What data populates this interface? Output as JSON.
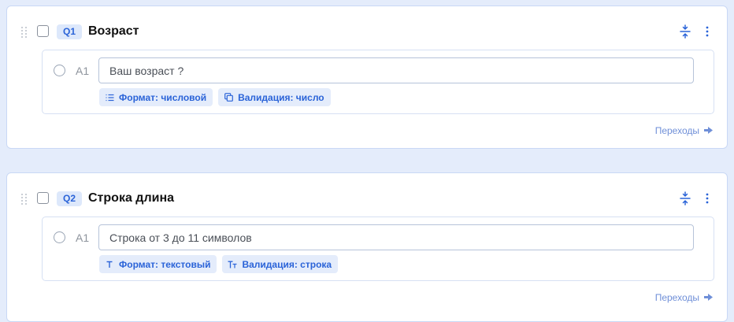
{
  "colors": {
    "accent": "#2a63d8",
    "background": "#e4ecfb",
    "chip_bg": "#e4ecfb",
    "link": "#6f8fd8"
  },
  "questions": [
    {
      "badge": "Q1",
      "title": "Возраст",
      "answer_label": "A1",
      "answer_placeholder": "Ваш возраст ?",
      "chips": [
        {
          "icon": "list-icon",
          "label": "Формат: числовой"
        },
        {
          "icon": "copy-icon",
          "label": "Валидация: число"
        }
      ],
      "transitions_label": "Переходы"
    },
    {
      "badge": "Q2",
      "title": "Строка длина",
      "answer_label": "A1",
      "answer_placeholder": "Строка от 3 до 11 символов",
      "chips": [
        {
          "icon": "text-icon",
          "label": "Формат: текстовый"
        },
        {
          "icon": "text-size-icon",
          "label": "Валидация: строка"
        }
      ],
      "transitions_label": "Переходы"
    }
  ]
}
